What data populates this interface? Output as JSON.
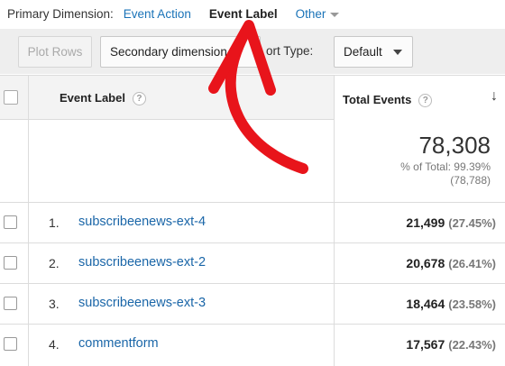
{
  "dimension_bar": {
    "label": "Primary Dimension:",
    "options": [
      "Event Action",
      "Event Label",
      "Other"
    ],
    "active": "Event Label",
    "other_caret_icon": "chevron-down-icon"
  },
  "toolbar": {
    "plot_rows_label": "Plot Rows",
    "secondary_dimension_label": "Secondary dimension",
    "sort_type_label": "ort Type:",
    "sort_type_value": "Default",
    "sort_caret_icon": "chevron-down-icon"
  },
  "table": {
    "header": {
      "event_label": "Event Label",
      "total_events": "Total Events",
      "help_glyph": "?",
      "sort_glyph": "↓"
    },
    "summary": {
      "total": "78,308",
      "percent_of_total": "% of Total: 99.39%",
      "absolute_total": "(78,788)"
    },
    "rows": [
      {
        "index": "1.",
        "label": "subscribeenews-ext-4",
        "value": "21,499",
        "percent": "(27.45%)"
      },
      {
        "index": "2.",
        "label": "subscribeenews-ext-2",
        "value": "20,678",
        "percent": "(26.41%)"
      },
      {
        "index": "3.",
        "label": "subscribeenews-ext-3",
        "value": "18,464",
        "percent": "(23.58%)"
      },
      {
        "index": "4.",
        "label": "commentform",
        "value": "17,567",
        "percent": "(22.43%)"
      }
    ]
  },
  "annotation": {
    "color": "#e8141b",
    "icon": "curved-arrow-annotation"
  }
}
